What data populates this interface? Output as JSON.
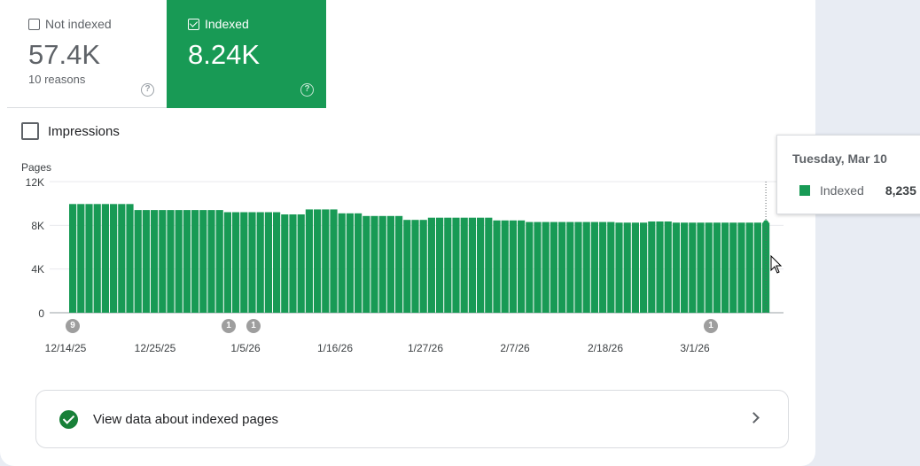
{
  "tiles": {
    "not_indexed": {
      "label": "Not indexed",
      "value": "57.4K",
      "sub": "10 reasons",
      "checked": false
    },
    "indexed": {
      "label": "Indexed",
      "value": "8.24K",
      "checked": true
    }
  },
  "impressions": {
    "label": "Impressions",
    "checked": false
  },
  "chart_data": {
    "type": "bar",
    "ylabel": "Pages",
    "yticks": [
      "12K",
      "8K",
      "4K",
      "0"
    ],
    "ylim": [
      0,
      12000
    ],
    "x_tick_labels": [
      "12/14/25",
      "12/25/25",
      "1/5/26",
      "1/16/26",
      "1/27/26",
      "2/7/26",
      "2/18/26",
      "3/1/26"
    ],
    "annotations": [
      {
        "label": "9",
        "date": "12/14/25"
      },
      {
        "label": "1",
        "date": "1/3/26"
      },
      {
        "label": "1",
        "date": "1/5/26"
      },
      {
        "label": "1",
        "date": "3/3/26"
      }
    ],
    "series": [
      {
        "name": "Indexed",
        "color": "#189a55",
        "start_date": "12/14/25",
        "values": [
          9950,
          9950,
          9950,
          9950,
          9950,
          9950,
          9950,
          9950,
          9400,
          9400,
          9400,
          9400,
          9400,
          9400,
          9400,
          9400,
          9400,
          9400,
          9400,
          9200,
          9200,
          9200,
          9200,
          9200,
          9200,
          9200,
          9000,
          9000,
          9000,
          9450,
          9450,
          9450,
          9450,
          9100,
          9100,
          9100,
          8850,
          8850,
          8850,
          8850,
          8850,
          8500,
          8500,
          8500,
          8700,
          8700,
          8700,
          8700,
          8700,
          8700,
          8700,
          8700,
          8450,
          8450,
          8450,
          8450,
          8300,
          8300,
          8300,
          8300,
          8300,
          8300,
          8300,
          8300,
          8300,
          8300,
          8300,
          8250,
          8250,
          8250,
          8250,
          8350,
          8350,
          8350,
          8250,
          8250,
          8250,
          8250,
          8250,
          8250,
          8250,
          8250,
          8250,
          8250,
          8250,
          8235
        ]
      }
    ]
  },
  "tooltip": {
    "date": "Tuesday, Mar 10",
    "series": "Indexed",
    "value": "8,235"
  },
  "link_card": {
    "label": "View data about indexed pages"
  }
}
